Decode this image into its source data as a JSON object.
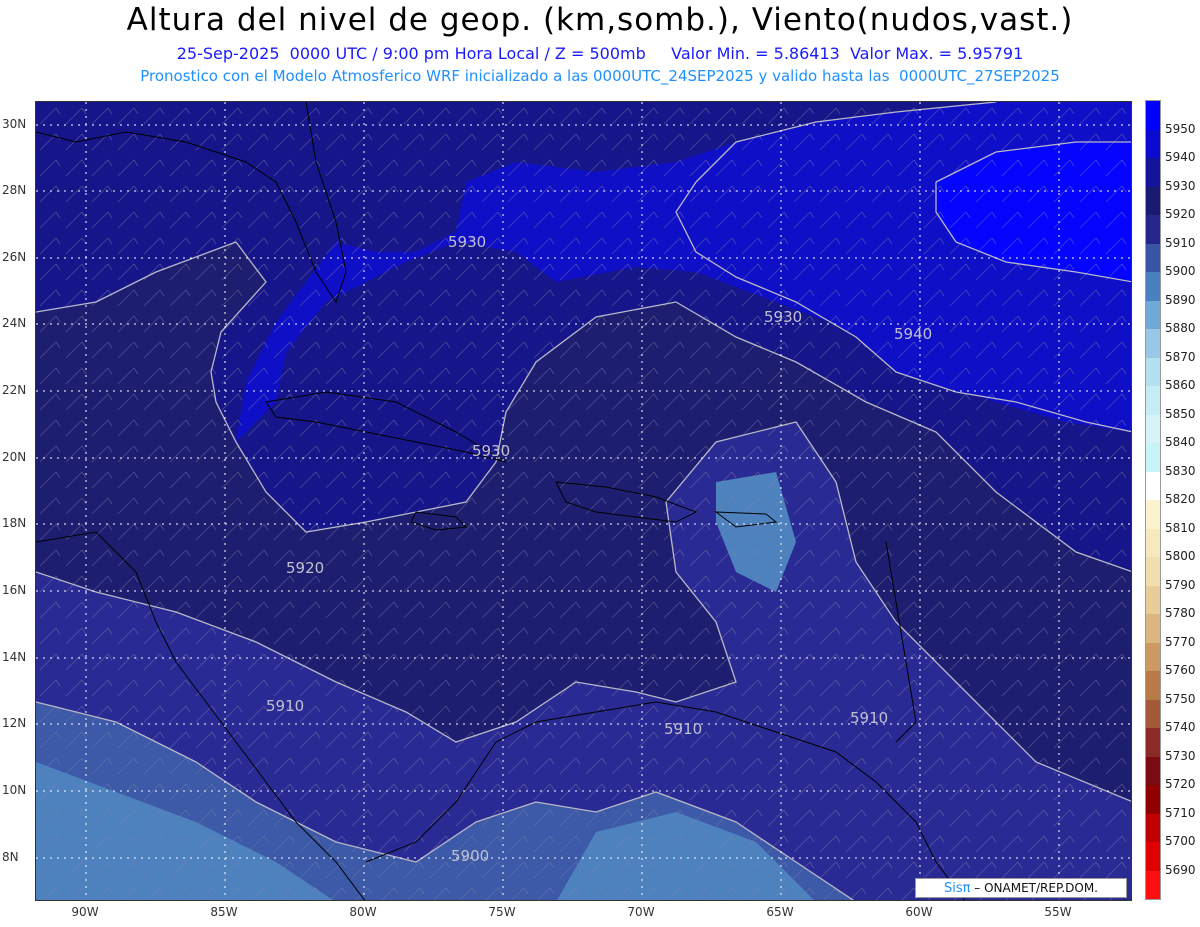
{
  "header": {
    "title": "Altura del nivel de geop. (km,somb.), Viento(nudos,vast.)",
    "line1": "25-Sep-2025  0000 UTC / 9:00 pm Hora Local / Z = 500mb     Valor Min. = 5.86413  Valor Max. = 5.95791",
    "line2": "Pronostico con el Modelo Atmosferico WRF inicializado a las 0000UTC_24SEP2025 y valido hasta las  0000UTC_27SEP2025"
  },
  "map": {
    "lat_labels": [
      "30N",
      "28N",
      "26N",
      "24N",
      "22N",
      "20N",
      "18N",
      "16N",
      "14N",
      "12N",
      "10N",
      "8N"
    ],
    "lon_labels": [
      "90W",
      "85W",
      "80W",
      "75W",
      "70W",
      "65W",
      "60W",
      "55W"
    ],
    "contour_labels": [
      {
        "text": "5930"
      },
      {
        "text": "5930"
      },
      {
        "text": "5940"
      },
      {
        "text": "5930"
      },
      {
        "text": "5920"
      },
      {
        "text": "5910"
      },
      {
        "text": "5910"
      },
      {
        "text": "5910"
      },
      {
        "text": "5900"
      }
    ],
    "colors": {
      "c5950": "#0505ff",
      "c5940": "#0f0fc8",
      "c5930": "#16168a",
      "c5920": "#1e1e70",
      "c5910": "#2a2a94",
      "c5900": "#3c5aa8",
      "c5890": "#4e82bf",
      "contour": "#b8b8c8",
      "land": "#000000",
      "grid": "#ffffff"
    }
  },
  "colorbar": {
    "levels": [
      "5950",
      "5940",
      "5930",
      "5920",
      "5910",
      "5900",
      "5890",
      "5880",
      "5870",
      "5860",
      "5850",
      "5840",
      "5830",
      "5820",
      "5810",
      "5800",
      "5790",
      "5780",
      "5770",
      "5760",
      "5750",
      "5740",
      "5730",
      "5720",
      "5710",
      "5700",
      "5690"
    ],
    "colors": [
      "#0000ff",
      "#0a0ad0",
      "#14149a",
      "#1a1a70",
      "#25258a",
      "#3a55a5",
      "#4a80bf",
      "#70a8d8",
      "#98c8e6",
      "#b4dff0",
      "#c8ecf5",
      "#d8f3f8",
      "#c8f4f8",
      "#ffffff",
      "#fbf3cf",
      "#f6e9c0",
      "#f1deaf",
      "#e8cd98",
      "#dcb680",
      "#cc9a60",
      "#b87b48",
      "#a45a38",
      "#8c2a28",
      "#7a0a14",
      "#900000",
      "#c00000",
      "#e00000",
      "#ff1010"
    ]
  },
  "credit": {
    "logo": "Sisπ",
    "text": "– ONAMET/REP.DOM."
  }
}
